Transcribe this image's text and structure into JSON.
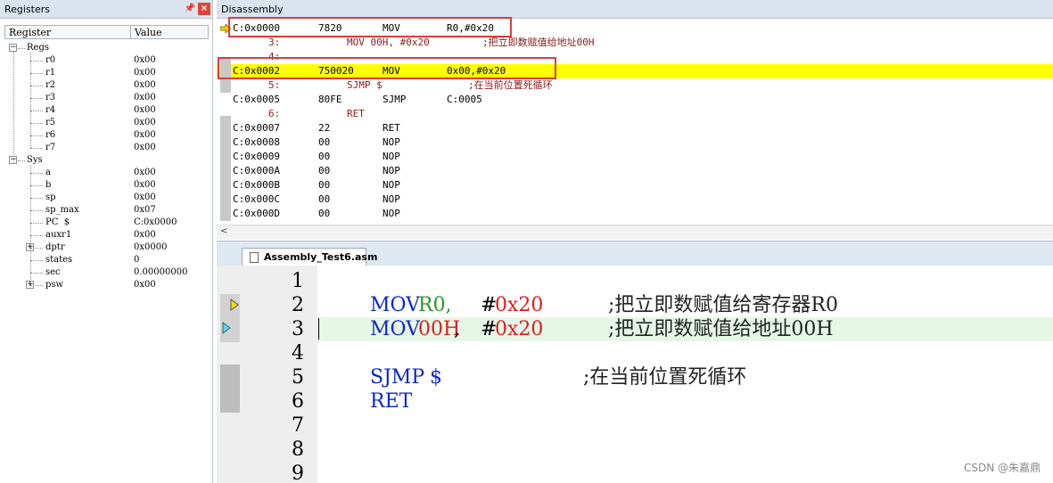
{
  "registers_pane": {
    "title": "Registers",
    "pin_icon": "pin-icon",
    "close_icon": "close-icon",
    "col_register": "Register",
    "col_value": "Value",
    "groups": [
      {
        "name": "Regs",
        "expander": "⊟",
        "items": [
          {
            "name": "r0",
            "value": "0x00"
          },
          {
            "name": "r1",
            "value": "0x00"
          },
          {
            "name": "r2",
            "value": "0x00"
          },
          {
            "name": "r3",
            "value": "0x00"
          },
          {
            "name": "r4",
            "value": "0x00"
          },
          {
            "name": "r5",
            "value": "0x00"
          },
          {
            "name": "r6",
            "value": "0x00"
          },
          {
            "name": "r7",
            "value": "0x00"
          }
        ]
      },
      {
        "name": "Sys",
        "expander": "⊟",
        "items": [
          {
            "name": "a",
            "value": "0x00"
          },
          {
            "name": "b",
            "value": "0x00"
          },
          {
            "name": "sp",
            "value": "0x00"
          },
          {
            "name": "sp_max",
            "value": "0x07"
          },
          {
            "name": "PC  $",
            "value": "C:0x0000"
          },
          {
            "name": "auxr1",
            "value": "0x00"
          },
          {
            "name": "dptr",
            "value": "0x0000",
            "expandable": true
          },
          {
            "name": "states",
            "value": "0"
          },
          {
            "name": "sec",
            "value": "0.00000000"
          },
          {
            "name": "psw",
            "value": "0x00",
            "expandable": true
          }
        ]
      }
    ]
  },
  "disassembly_pane": {
    "title": "Disassembly",
    "lines": [
      {
        "kind": "asm",
        "addr": "C:0x0000",
        "bytes": "7820",
        "mnem": "MOV",
        "ops": "R0,#0x20",
        "boxed": true
      },
      {
        "kind": "src",
        "num": "3:",
        "text": "MOV 00H, #0x20",
        "comment": ";把立即数赋值给地址00H"
      },
      {
        "kind": "src",
        "num": "4:",
        "text": "",
        "comment": ""
      },
      {
        "kind": "asm",
        "addr": "C:0x0002",
        "bytes": "750020",
        "mnem": "MOV",
        "ops": "0x00,#0x20",
        "boxed": true,
        "highlight": true
      },
      {
        "kind": "src",
        "num": "5:",
        "text": "SJMP $",
        "comment": ";在当前位置死循环"
      },
      {
        "kind": "asm",
        "addr": "C:0x0005",
        "bytes": "80FE",
        "mnem": "SJMP",
        "ops": "C:0005"
      },
      {
        "kind": "src",
        "num": "6:",
        "text": "RET",
        "comment": ""
      },
      {
        "kind": "asm",
        "addr": "C:0x0007",
        "bytes": "22",
        "mnem": "RET",
        "ops": ""
      },
      {
        "kind": "asm",
        "addr": "C:0x0008",
        "bytes": "00",
        "mnem": "NOP",
        "ops": ""
      },
      {
        "kind": "asm",
        "addr": "C:0x0009",
        "bytes": "00",
        "mnem": "NOP",
        "ops": ""
      },
      {
        "kind": "asm",
        "addr": "C:0x000A",
        "bytes": "00",
        "mnem": "NOP",
        "ops": ""
      },
      {
        "kind": "asm",
        "addr": "C:0x000B",
        "bytes": "00",
        "mnem": "NOP",
        "ops": ""
      },
      {
        "kind": "asm",
        "addr": "C:0x000C",
        "bytes": "00",
        "mnem": "NOP",
        "ops": ""
      },
      {
        "kind": "asm",
        "addr": "C:0x000D",
        "bytes": "00",
        "mnem": "NOP",
        "ops": ""
      }
    ],
    "scroll_left_glyph": "<"
  },
  "editor": {
    "tab_label": "Assembly_Test6.asm",
    "line_numbers": [
      "1",
      "2",
      "3",
      "4",
      "5",
      "6",
      "7",
      "8",
      "9"
    ],
    "lines": [
      {
        "n": "1",
        "tokens": []
      },
      {
        "n": "2",
        "tokens": [
          {
            "t": "MOV",
            "c": "kw"
          },
          {
            "t": "R0,",
            "c": "reg"
          },
          {
            "t": "#",
            "c": "txt"
          },
          {
            "t": "0x20",
            "c": "num"
          },
          {
            "t": ";把立即数赋值给寄存器R0",
            "c": "cm"
          }
        ]
      },
      {
        "n": "3",
        "current": true,
        "tokens": [
          {
            "t": "MOV",
            "c": "kw"
          },
          {
            "t": "00H",
            "c": "num"
          },
          {
            "t": ",",
            "c": "txt"
          },
          {
            "t": "#",
            "c": "txt"
          },
          {
            "t": "0x20",
            "c": "num"
          },
          {
            "t": ";把立即数赋值给地址00H",
            "c": "cm"
          }
        ]
      },
      {
        "n": "4",
        "tokens": []
      },
      {
        "n": "5",
        "tokens": [
          {
            "t": "SJMP",
            "c": "kw"
          },
          {
            "t": "$",
            "c": "kw"
          },
          {
            "t": ";在当前位置死循环",
            "c": "cm"
          }
        ]
      },
      {
        "n": "6",
        "tokens": [
          {
            "t": "RET",
            "c": "kw"
          }
        ]
      },
      {
        "n": "7",
        "tokens": []
      },
      {
        "n": "8",
        "tokens": []
      },
      {
        "n": "9",
        "tokens": []
      }
    ]
  },
  "watermark": "CSDN @朱嘉鼎",
  "colors": {
    "highlight_line": "#ffff00",
    "red_box": "#e0393e",
    "keyword": "#0a27c9",
    "register": "#249a24",
    "number": "#e01b1b",
    "current_line": "#e6f7e8"
  }
}
